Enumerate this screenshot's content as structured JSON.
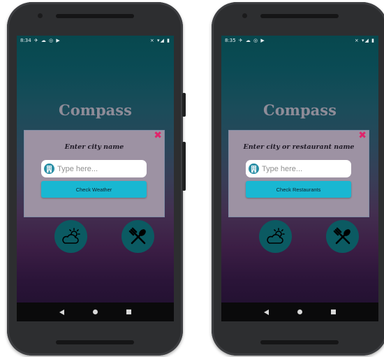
{
  "screens": [
    {
      "status_time": "8:34",
      "status_left_icons": "✈ ☁ ◎ ▶",
      "status_right_icons": "⨯ ▾◢ ▮",
      "app_title": "Compass",
      "dialog": {
        "title": "Enter city name",
        "input_placeholder": "Type here...",
        "button_label": "Check Weather",
        "close_symbol": "✖"
      }
    },
    {
      "status_time": "8:35",
      "status_left_icons": "✈ ☁ ◎ ▶",
      "status_right_icons": "⨯ ▾◢ ▮",
      "app_title": "Compass",
      "dialog": {
        "title": "Enter city or restaurant name",
        "input_placeholder": "Type here...",
        "button_label": "Check Restaurants",
        "close_symbol": "✖"
      }
    }
  ],
  "icons": {
    "input_icon": "building-icon",
    "weather_button_icon": "cloud-sun-icon",
    "food_button_icon": "fork-spoon-icon"
  },
  "colors": {
    "accent_cyan": "#19b7d2",
    "close_pink": "#e0246b",
    "dialog_bg": "#9d92a3",
    "circle_bg": "#0b5a62"
  }
}
